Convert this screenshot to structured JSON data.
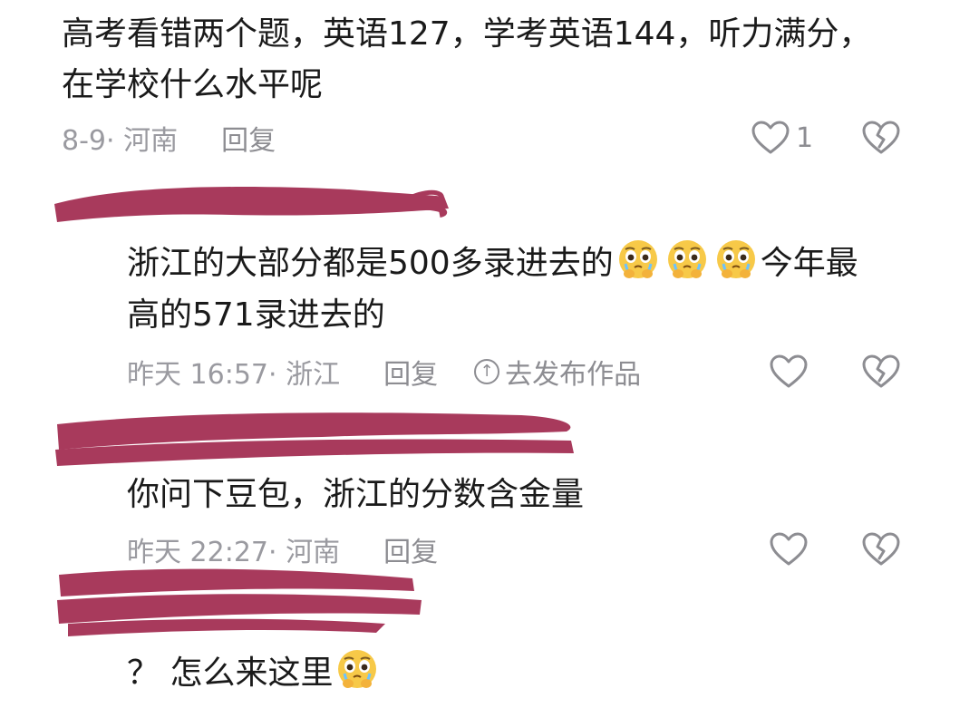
{
  "comments": [
    {
      "text_line1": "高考看错两个题，英语127，学考英语144，听力满分，",
      "text_line2": "在学校什么水平呢",
      "time_loc": "8-9· 河南",
      "reply_label": "回复",
      "like_count": "1"
    },
    {
      "text_line1_part1": "浙江的大部分都是500多录进去的",
      "text_line1_part2": "今年最",
      "text_line2": "高的571录进去的",
      "time_loc": "昨天 16:57· 浙江",
      "reply_label": "回复",
      "post_label": "去发布作品"
    },
    {
      "text": "你问下豆包，浙江的分数含金量",
      "time_loc": "昨天 22:27· 河南",
      "reply_label": "回复"
    },
    {
      "text": "？ 怎么来这里"
    }
  ],
  "icons": {
    "like": "heart-outline-icon",
    "dislike": "broken-heart-icon",
    "emoji": "crying-pleading-emoji",
    "post": "upload-arrow-circle-icon"
  },
  "colors": {
    "redaction": "#a83a5c",
    "meta_text": "#9a9aa0",
    "body_text": "#1a1a1a"
  }
}
